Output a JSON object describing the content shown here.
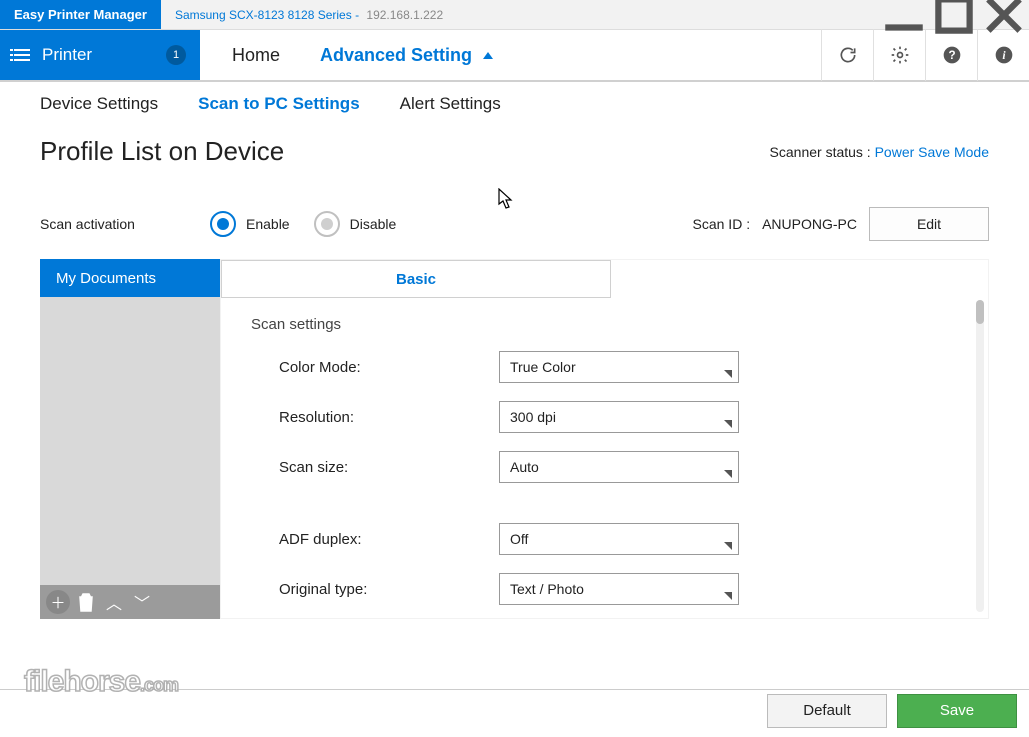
{
  "titlebar": {
    "app_name": "Easy Printer Manager",
    "device_name": "Samsung SCX-8123 8128 Series",
    "ip": "192.168.1.222"
  },
  "navbar": {
    "printer_label": "Printer",
    "printer_badge": "1",
    "home_label": "Home",
    "advanced_label": "Advanced Setting"
  },
  "subnav": {
    "device_settings": "Device Settings",
    "scan_to_pc": "Scan to PC Settings",
    "alert_settings": "Alert Settings"
  },
  "page": {
    "title": "Profile List on Device",
    "scanner_status_label": "Scanner status : ",
    "scanner_status_value": "Power Save Mode"
  },
  "activation": {
    "label": "Scan activation",
    "enable": "Enable",
    "disable": "Disable"
  },
  "scanid": {
    "label": "Scan ID :",
    "value": "ANUPONG-PC",
    "edit": "Edit"
  },
  "profiles": {
    "items": [
      "My Documents"
    ]
  },
  "settings_tabs": {
    "basic": "Basic"
  },
  "settings": {
    "section_label": "Scan settings",
    "rows": [
      {
        "label": "Color Mode:",
        "value": "True Color"
      },
      {
        "label": "Resolution:",
        "value": "300 dpi"
      },
      {
        "label": "Scan size:",
        "value": "Auto"
      },
      {
        "label": "ADF duplex:",
        "value": "Off"
      },
      {
        "label": "Original type:",
        "value": "Text / Photo"
      }
    ]
  },
  "footer": {
    "default": "Default",
    "save": "Save"
  },
  "watermark": {
    "brand": "filehorse",
    "domain": ".com"
  }
}
